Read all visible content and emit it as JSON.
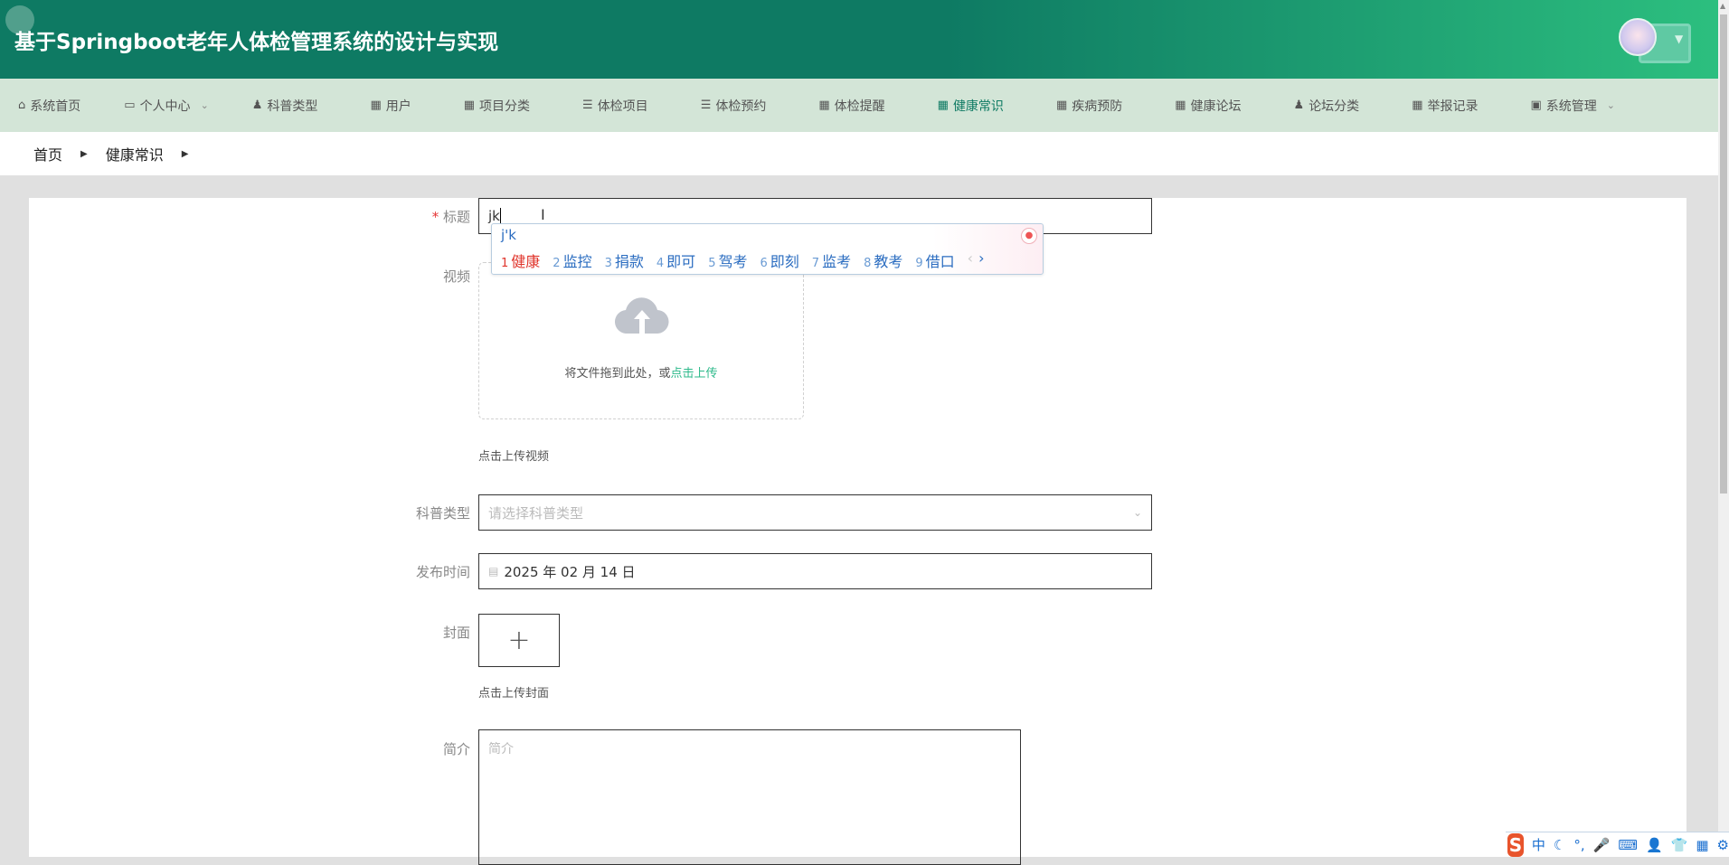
{
  "header": {
    "title": "基于Springboot老年人体检管理系统的设计与实现"
  },
  "nav": [
    {
      "label": "系统首页",
      "icon": "home-icon",
      "glyph": "⌂"
    },
    {
      "label": "个人中心",
      "icon": "id-card-icon",
      "glyph": "▭",
      "dropdown": "⌄"
    },
    {
      "label": "科普类型",
      "icon": "user-icon",
      "glyph": "♟"
    },
    {
      "label": "用户",
      "icon": "grid-icon",
      "glyph": "▦"
    },
    {
      "label": "项目分类",
      "icon": "grid-icon",
      "glyph": "▦"
    },
    {
      "label": "体检项目",
      "icon": "list-icon",
      "glyph": "☰"
    },
    {
      "label": "体检预约",
      "icon": "list-icon",
      "glyph": "☰"
    },
    {
      "label": "体检提醒",
      "icon": "grid-9-icon",
      "glyph": "▦"
    },
    {
      "label": "健康常识",
      "icon": "grid-icon",
      "glyph": "▦",
      "active": true
    },
    {
      "label": "疾病预防",
      "icon": "grid-icon",
      "glyph": "▦"
    },
    {
      "label": "健康论坛",
      "icon": "grid-icon",
      "glyph": "▦"
    },
    {
      "label": "论坛分类",
      "icon": "user-icon",
      "glyph": "♟"
    },
    {
      "label": "举报记录",
      "icon": "grid-icon",
      "glyph": "▦"
    },
    {
      "label": "系统管理",
      "icon": "clipboard-icon",
      "glyph": "▣",
      "dropdown": "⌄"
    }
  ],
  "breadcrumb": {
    "home": "首页",
    "current": "健康常识"
  },
  "form": {
    "title_label": "标题",
    "required_mark": "*",
    "title_value": "jk",
    "video_label": "视频",
    "upload_text": "将文件拖到此处，或",
    "upload_link": "点击上传",
    "video_tip": "点击上传视频",
    "type_label": "科普类型",
    "type_placeholder": "请选择科普类型",
    "date_label": "发布时间",
    "date_value": "2025 年 02 月 14 日",
    "cover_label": "封面",
    "cover_plus": "+",
    "cover_tip": "点击上传封面",
    "intro_label": "简介",
    "intro_placeholder": "简介"
  },
  "ime": {
    "composition": "j'k",
    "candidates": [
      {
        "n": "1",
        "text": "健康"
      },
      {
        "n": "2",
        "text": "监控"
      },
      {
        "n": "3",
        "text": "捐款"
      },
      {
        "n": "4",
        "text": "即可"
      },
      {
        "n": "5",
        "text": "驾考"
      },
      {
        "n": "6",
        "text": "即刻"
      },
      {
        "n": "7",
        "text": "监考"
      },
      {
        "n": "8",
        "text": "教考"
      },
      {
        "n": "9",
        "text": "借口"
      }
    ],
    "prev": "‹",
    "next": "›",
    "toolbar": {
      "logo": "S",
      "mode": "中",
      "items": [
        "☾",
        "°,",
        "🎤",
        "⌨",
        "👤",
        "👕",
        "▦",
        "⚙"
      ]
    }
  },
  "colors": {
    "header": "#0e7a63",
    "nav_bg": "#d3e5d7",
    "accent": "#2cb98a"
  }
}
